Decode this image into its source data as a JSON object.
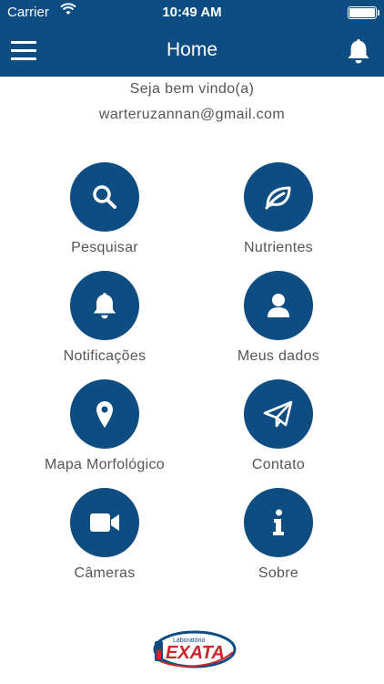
{
  "status_bar": {
    "carrier": "Carrier",
    "time": "10:49 AM"
  },
  "nav": {
    "title": "Home"
  },
  "welcome": {
    "greeting": "Seja bem vindo(a)",
    "email": "warteruzannan@gmail.com"
  },
  "menu": [
    {
      "label": "Pesquisar",
      "icon": "search-icon"
    },
    {
      "label": "Nutrientes",
      "icon": "leaf-icon"
    },
    {
      "label": "Notificações",
      "icon": "bell-icon"
    },
    {
      "label": "Meus dados",
      "icon": "user-icon"
    },
    {
      "label": "Mapa Morfológico",
      "icon": "map-pin-icon"
    },
    {
      "label": "Contato",
      "icon": "paper-plane-icon"
    },
    {
      "label": "Câmeras",
      "icon": "video-camera-icon"
    },
    {
      "label": "Sobre",
      "icon": "info-icon"
    }
  ],
  "logo": {
    "small_text": "Laboratório",
    "brand": "EXATA"
  },
  "colors": {
    "primary": "#0d4d82",
    "text": "#555555",
    "logo_red": "#d0242b"
  }
}
